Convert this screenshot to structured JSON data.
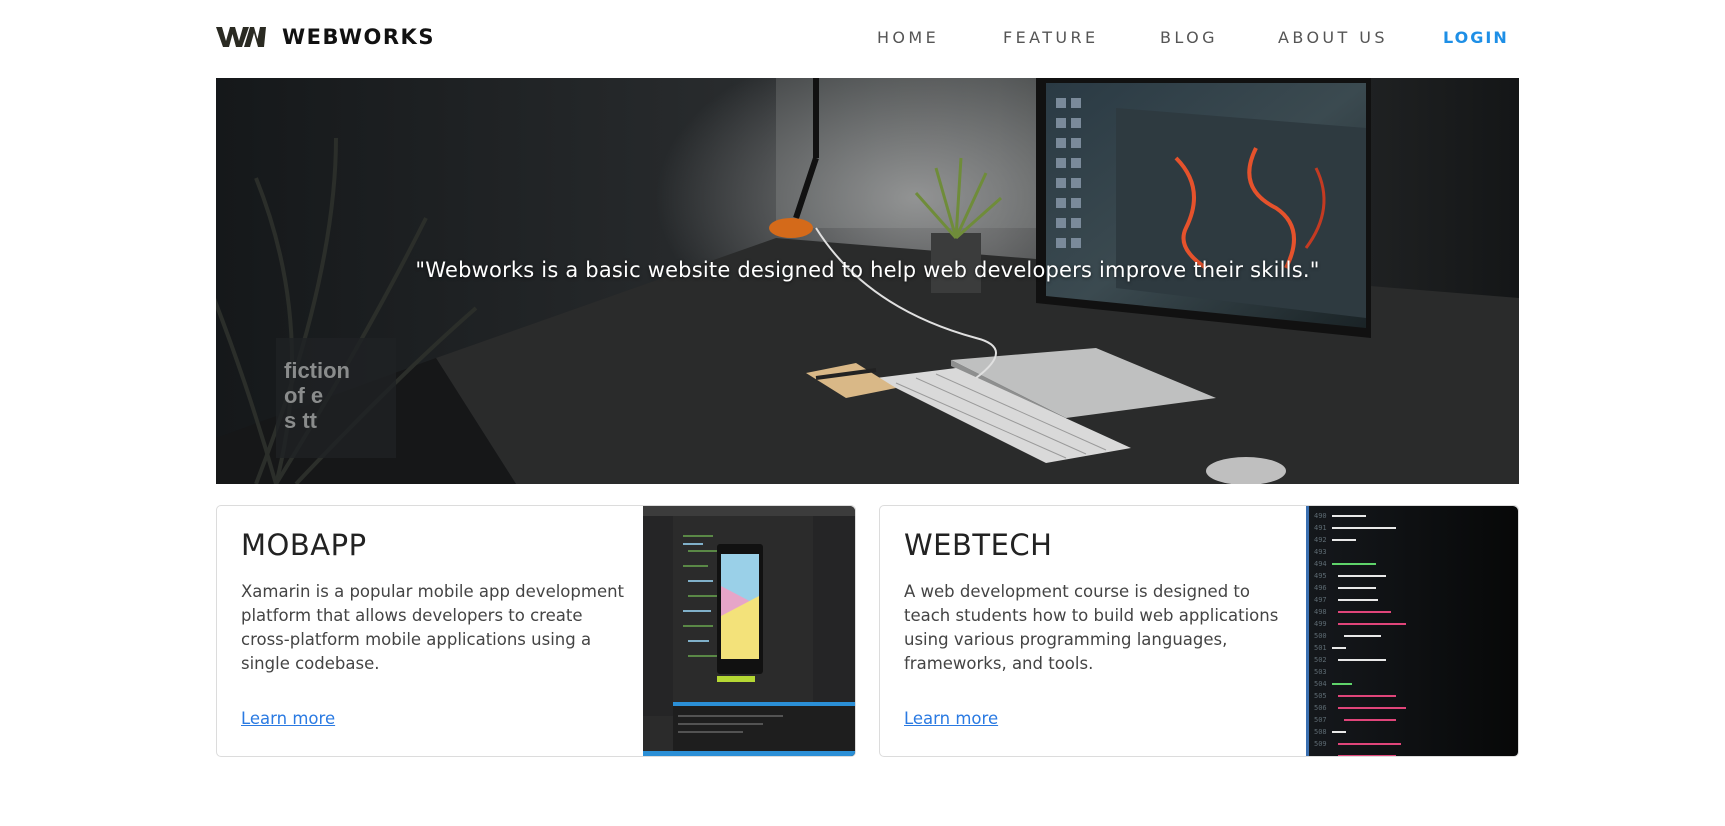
{
  "brand": {
    "name": "WEBWORKS",
    "logo_icon": "ww-logo-icon"
  },
  "nav": {
    "items": [
      {
        "label": "HOME"
      },
      {
        "label": "FEATURE"
      },
      {
        "label": "BLOG"
      },
      {
        "label": "ABOUT US"
      },
      {
        "label": "LOGIN"
      }
    ],
    "login_color": "#1e8fe6"
  },
  "hero": {
    "quote": "\"Webworks is a basic website designed to help web developers improve their skills.\""
  },
  "cards": [
    {
      "title": "MOBAPP",
      "text": "Xamarin is a popular mobile app development platform that allows developers to create cross-platform mobile applications using a single codebase.",
      "link": "Learn more"
    },
    {
      "title": "WEBTECH",
      "text": "A web development course is designed to teach students how to build web applications using various programming languages, frameworks, and tools.",
      "link": "Learn more"
    }
  ],
  "colors": {
    "accent": "#1e8fe6",
    "link": "#2a7ae2"
  }
}
